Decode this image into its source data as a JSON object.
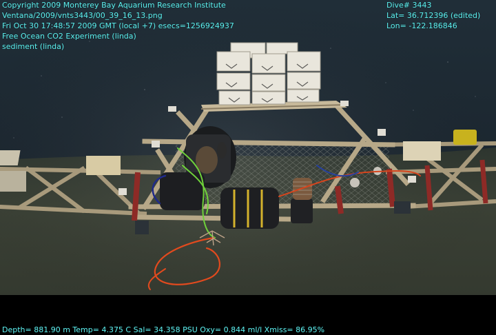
{
  "overlay": {
    "top_left": [
      "Copyright 2009 Monterey Bay Aquarium Research Institute",
      "Ventana/2009/vnts3443/00_39_16_13.png",
      "Fri Oct 30 17:48:57 2009 GMT (local +7)  esecs=1256924937",
      "Free Ocean CO2 Experiment (linda)",
      "sediment (linda)"
    ],
    "top_right": [
      "Dive# 3443",
      "Lat= 36.712396 (edited)",
      "Lon= -122.186846"
    ],
    "bottom": "Depth= 881.90 m  Temp= 4.375 C  Sal= 34.358 PSU  Oxy= 0.844 ml/l  Xmiss= 86.95%"
  },
  "colors": {
    "overlay_text": "#5ff0f0",
    "water": "#1f2a34",
    "seafloor": "#3b4136",
    "frame_wood": "#b8a888",
    "frame_red": "#8e2a26",
    "orange_cable": "#e24a1e",
    "green_cable": "#6fd13a"
  }
}
